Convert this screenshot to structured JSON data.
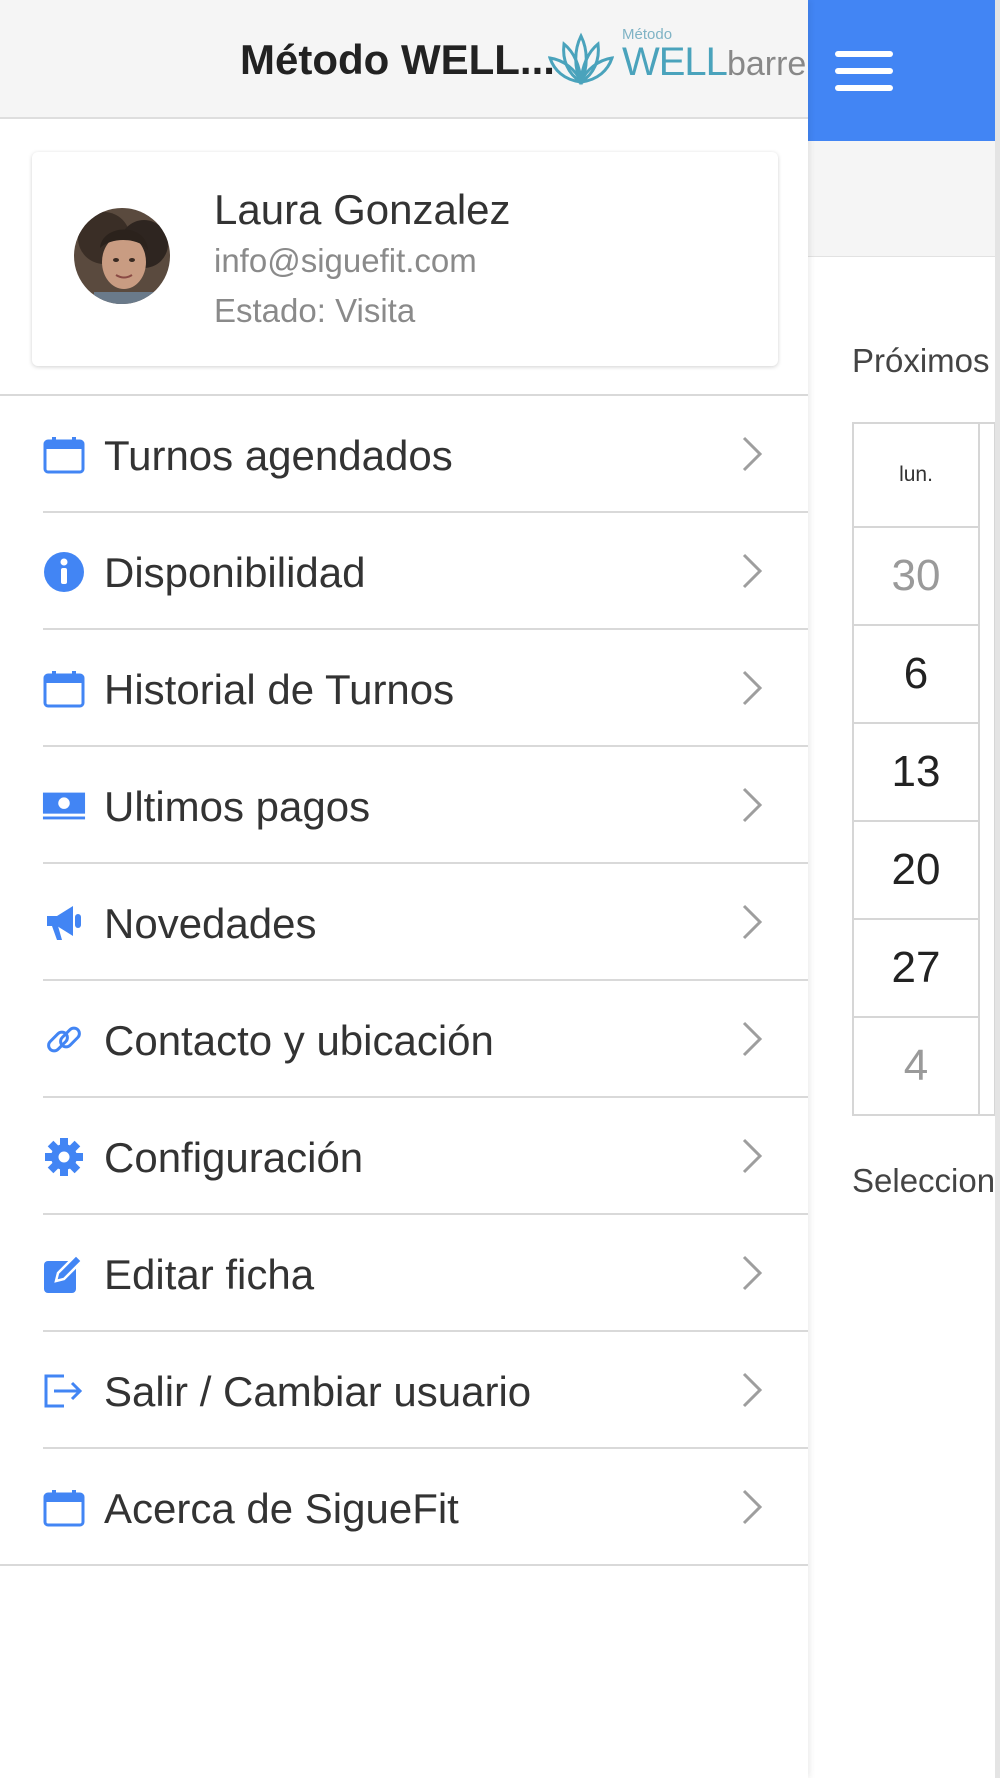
{
  "drawer": {
    "title": "Método WELL...",
    "logo": {
      "small_text": "Método",
      "brand_well": "WELL",
      "brand_barre": "barre"
    }
  },
  "profile": {
    "name": "Laura Gonzalez",
    "email": "info@siguefit.com",
    "status": "Estado: Visita"
  },
  "menu": {
    "items": [
      {
        "label": "Turnos agendados",
        "icon": "calendar-icon"
      },
      {
        "label": "Disponibilidad",
        "icon": "info-icon"
      },
      {
        "label": "Historial de Turnos",
        "icon": "calendar-icon"
      },
      {
        "label": "Ultimos pagos",
        "icon": "money-icon"
      },
      {
        "label": "Novedades",
        "icon": "megaphone-icon"
      },
      {
        "label": "Contacto y ubicación",
        "icon": "link-icon"
      },
      {
        "label": "Configuración",
        "icon": "gear-icon"
      },
      {
        "label": "Editar ficha",
        "icon": "edit-icon"
      },
      {
        "label": "Salir / Cambiar usuario",
        "icon": "logout-icon"
      },
      {
        "label": "Acerca de SigueFit",
        "icon": "calendar-icon"
      }
    ]
  },
  "background": {
    "upcoming_label": "Próximos",
    "calendar": {
      "weekday": "lun.",
      "days": [
        "30",
        "6",
        "13",
        "20",
        "27",
        "4"
      ]
    },
    "select_label": "Seleccion"
  },
  "colors": {
    "accent": "#4285f4",
    "logo": "#4aa3bc"
  }
}
